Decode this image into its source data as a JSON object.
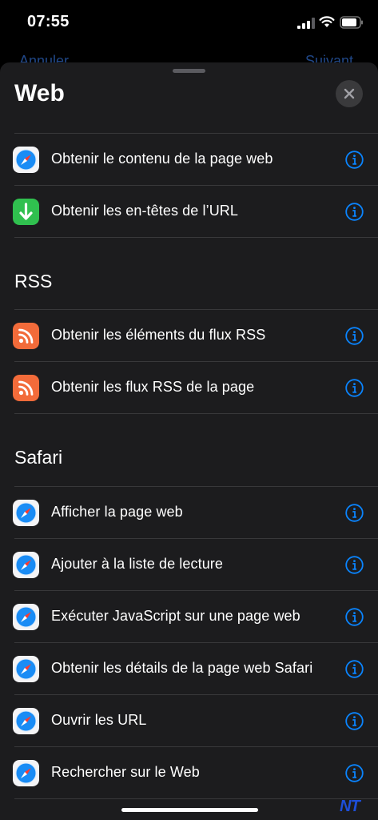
{
  "status_bar": {
    "time": "07:55"
  },
  "background_nav": {
    "left": "Annuler",
    "right": "Suivant"
  },
  "sheet": {
    "title": "Web",
    "top_items": [
      {
        "label": "Obtenir le contenu de la page web",
        "icon": "safari-icon"
      },
      {
        "label": "Obtenir les en-têtes de l’URL",
        "icon": "download-arrow-icon"
      }
    ],
    "sections": [
      {
        "title": "RSS",
        "items": [
          {
            "label": "Obtenir les éléments du flux RSS",
            "icon": "rss-icon"
          },
          {
            "label": "Obtenir les flux RSS de la page",
            "icon": "rss-icon"
          }
        ]
      },
      {
        "title": "Safari",
        "items": [
          {
            "label": "Afficher la page web",
            "icon": "safari-icon"
          },
          {
            "label": "Ajouter à la liste de lecture",
            "icon": "safari-icon"
          },
          {
            "label": "Exécuter JavaScript sur une page web",
            "icon": "safari-icon"
          },
          {
            "label": "Obtenir les détails de la page web Safari",
            "icon": "safari-icon"
          },
          {
            "label": "Ouvrir les URL",
            "icon": "safari-icon"
          },
          {
            "label": "Rechercher sur le Web",
            "icon": "safari-icon"
          }
        ]
      }
    ]
  },
  "watermark": "NT",
  "colors": {
    "accent": "#0a84ff",
    "sheet_bg": "#1c1c1e",
    "rss": "#f26b3a",
    "green": "#30c04f"
  }
}
